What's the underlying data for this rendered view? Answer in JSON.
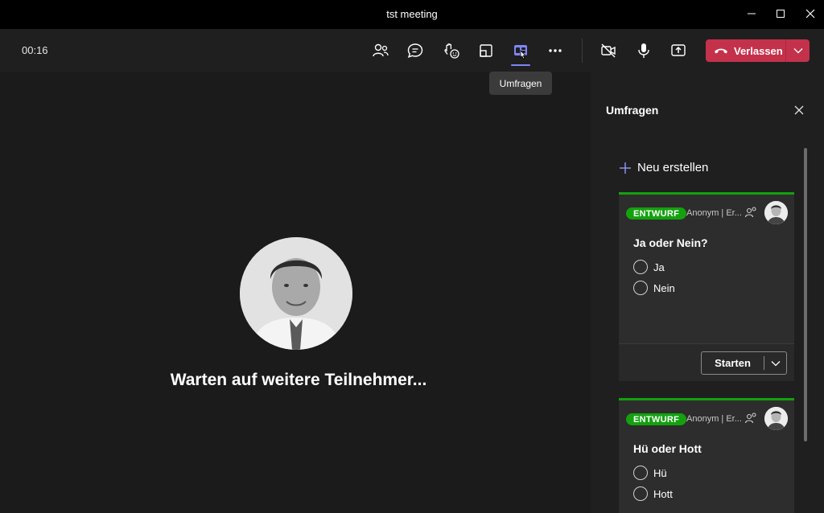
{
  "window": {
    "title": "tst meeting"
  },
  "toolbar": {
    "timer": "00:16",
    "leave_label": "Verlassen",
    "tooltip": "Umfragen"
  },
  "stage": {
    "waiting_text": "Warten auf weitere Teilnehmer..."
  },
  "panel": {
    "title": "Umfragen",
    "new_label": "Neu erstellen",
    "polls": [
      {
        "status": "ENTWURF",
        "meta": "Anonym | Er...",
        "question": "Ja oder Nein?",
        "options": [
          "Ja",
          "Nein"
        ],
        "start_label": "Starten"
      },
      {
        "status": "ENTWURF",
        "meta": "Anonym | Er...",
        "question": "Hü oder Hott",
        "options": [
          "Hü",
          "Hott"
        ]
      }
    ]
  },
  "colors": {
    "accent": "#7f85f5",
    "leave": "#c4314b",
    "draft_badge": "#13a10e"
  }
}
